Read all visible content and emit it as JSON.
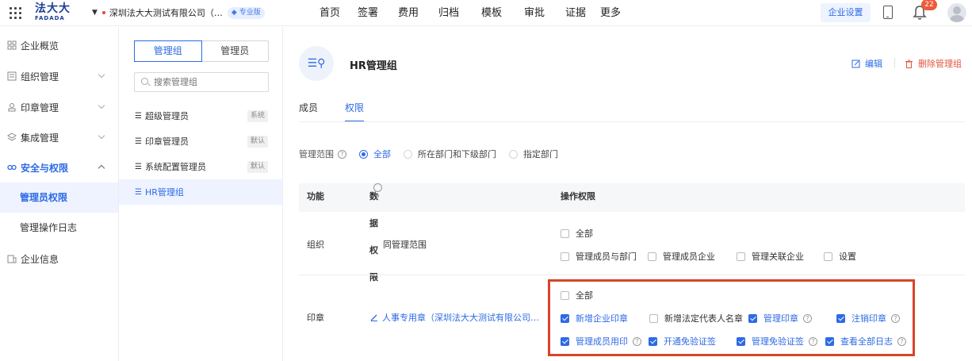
{
  "topbar": {
    "logo_cn": "法大大",
    "logo_en": "FADADA",
    "company": "深圳法大大测试有限公司（…",
    "edition_badge": "专业版",
    "nav": [
      "首页",
      "签署",
      "费用",
      "归档",
      "模板",
      "审批",
      "证据",
      "更多"
    ],
    "settings_label": "企业设置",
    "notification_count": "22"
  },
  "sidebar": {
    "items": [
      {
        "label": "企业概览",
        "icon": "overview-icon"
      },
      {
        "label": "组织管理",
        "icon": "org-icon"
      },
      {
        "label": "印章管理",
        "icon": "seal-icon"
      },
      {
        "label": "集成管理",
        "icon": "integration-icon"
      },
      {
        "label": "安全与权限",
        "icon": "security-icon"
      },
      {
        "label": "企业信息",
        "icon": "company-info-icon"
      }
    ],
    "sub_items": [
      "管理员权限",
      "管理操作日志"
    ]
  },
  "groups_panel": {
    "tab_groups": "管理组",
    "tab_admins": "管理员",
    "search_placeholder": "搜索管理组",
    "groups": [
      {
        "name": "超级管理员",
        "tag": "系统"
      },
      {
        "name": "印章管理员",
        "tag": "默认"
      },
      {
        "name": "系统配置管理员",
        "tag": "默认"
      },
      {
        "name": "HR管理组",
        "tag": ""
      }
    ]
  },
  "detail": {
    "title": "HR管理组",
    "edit_label": "编辑",
    "delete_label": "删除管理组",
    "tabs": [
      "成员",
      "权限"
    ],
    "scope": {
      "label": "管理范围",
      "options": [
        "全部",
        "所在部门和下级部门",
        "指定部门"
      ],
      "selected": "全部"
    },
    "table": {
      "headers": [
        "功能",
        "数据权限",
        "操作权限"
      ],
      "rows": [
        {
          "function": "组织",
          "data_scope": "同管理范围",
          "all_label": "全部",
          "all_checked": false,
          "permissions": [
            {
              "label": "管理成员与部门",
              "checked": false
            },
            {
              "label": "管理成员企业",
              "checked": false
            },
            {
              "label": "管理关联企业",
              "checked": false
            },
            {
              "label": "设置",
              "checked": false
            }
          ]
        },
        {
          "function": "印章",
          "data_scope": "人事专用章（深圳法大大测试有限公司…",
          "all_label": "全部",
          "all_checked": false,
          "permissions": [
            {
              "label": "新增企业印章",
              "checked": true
            },
            {
              "label": "新增法定代表人名章",
              "checked": false
            },
            {
              "label": "管理印章",
              "checked": true
            },
            {
              "label": "注销印章",
              "checked": true
            },
            {
              "label": "管理成员用印",
              "checked": true
            },
            {
              "label": "开通免验证签",
              "checked": true
            },
            {
              "label": "管理免验证签",
              "checked": true
            },
            {
              "label": "查看全部日志",
              "checked": true
            }
          ]
        }
      ]
    }
  },
  "colors": {
    "accent": "#2d6ae5",
    "danger": "#e1553f",
    "highlight": "#d8442a"
  }
}
